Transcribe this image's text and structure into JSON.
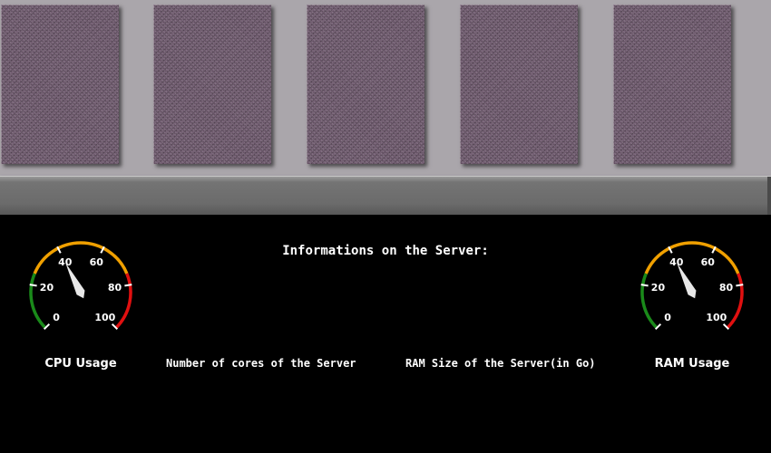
{
  "panels": [
    "server-panel-1",
    "server-panel-2",
    "server-panel-3",
    "server-panel-4",
    "server-panel-5"
  ],
  "info": {
    "title": "Informations on the Server:",
    "cores_label": "Number of cores of the Server",
    "ram_size_label": "RAM Size of the Server(in Go)"
  },
  "gauges": {
    "cpu": {
      "label": "CPU Usage",
      "value": 40,
      "min": 0,
      "max": 100
    },
    "ram": {
      "label": "RAM Usage",
      "value": 40,
      "min": 0,
      "max": 100
    },
    "ticks": [
      "0",
      "20",
      "40",
      "60",
      "80",
      "100"
    ],
    "zones": [
      {
        "from": 0,
        "to": 25,
        "color": "#1a8a1a"
      },
      {
        "from": 25,
        "to": 75,
        "color": "#f0a000"
      },
      {
        "from": 75,
        "to": 100,
        "color": "#e01010"
      }
    ],
    "needle_color": "#e8e8e8"
  }
}
